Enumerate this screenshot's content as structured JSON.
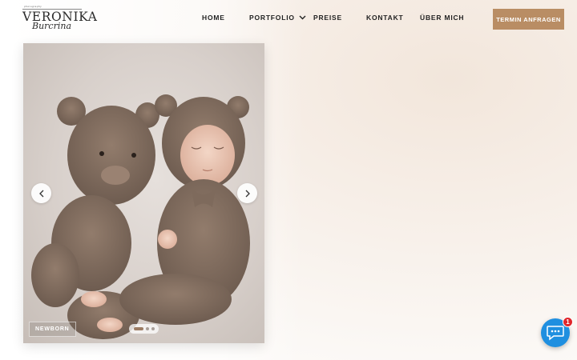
{
  "brand": {
    "tagline": "photography",
    "name": "VERONIKA",
    "script": "Burcrina"
  },
  "nav": {
    "home": "HOME",
    "portfolio": "PORTFOLIO",
    "preise": "PREISE",
    "kontakt": "KONTAKT",
    "ueber": "ÜBER MICH"
  },
  "cta": {
    "label": "TERMIN ANFRAGEN"
  },
  "slider": {
    "caption": "NEWBORN",
    "slide_count": 3,
    "active_index": 0,
    "image": "newborn baby in knitted bear outfit with teddy bear"
  },
  "chat": {
    "badge": "1"
  },
  "colors": {
    "accent": "#b98d64",
    "chat": "#1f8fe0",
    "badge": "#e0262b"
  }
}
